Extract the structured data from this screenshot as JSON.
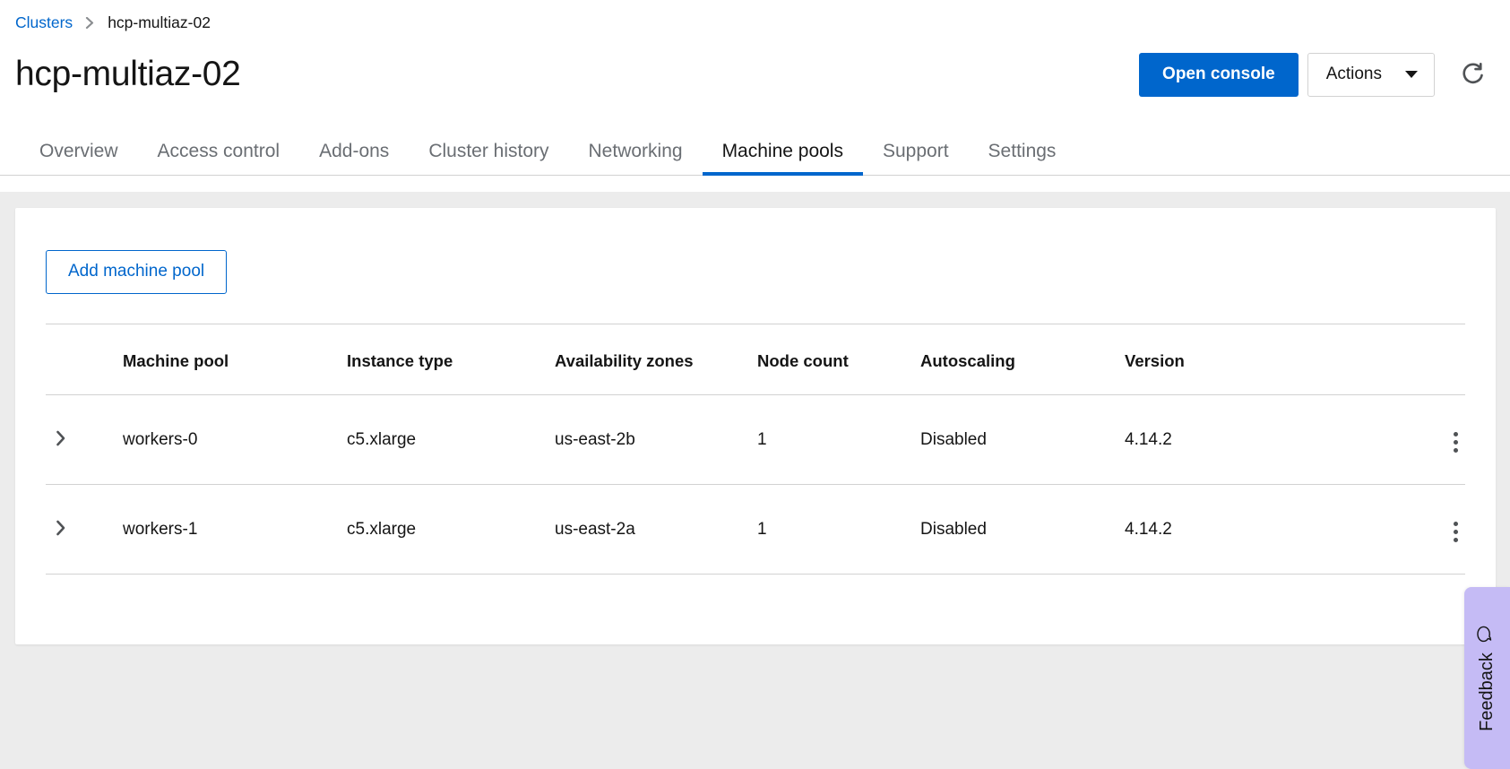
{
  "breadcrumb": {
    "root_label": "Clusters",
    "separator": "›",
    "current_label": "hcp-multiaz-02"
  },
  "header": {
    "title": "hcp-multiaz-02",
    "open_console_label": "Open console",
    "actions_label": "Actions",
    "refresh_icon": "refresh-icon"
  },
  "tabs": [
    {
      "label": "Overview",
      "active": false
    },
    {
      "label": "Access control",
      "active": false
    },
    {
      "label": "Add-ons",
      "active": false
    },
    {
      "label": "Cluster history",
      "active": false
    },
    {
      "label": "Networking",
      "active": false
    },
    {
      "label": "Machine pools",
      "active": true
    },
    {
      "label": "Support",
      "active": false
    },
    {
      "label": "Settings",
      "active": false
    }
  ],
  "toolbar": {
    "add_machine_pool_label": "Add machine pool"
  },
  "table": {
    "columns": [
      "Machine pool",
      "Instance type",
      "Availability zones",
      "Node count",
      "Autoscaling",
      "Version"
    ],
    "rows": [
      {
        "machine_pool": "workers-0",
        "instance_type": "c5.xlarge",
        "availability_zones": "us-east-2b",
        "node_count": "1",
        "autoscaling": "Disabled",
        "version": "4.14.2"
      },
      {
        "machine_pool": "workers-1",
        "instance_type": "c5.xlarge",
        "availability_zones": "us-east-2a",
        "node_count": "1",
        "autoscaling": "Disabled",
        "version": "4.14.2"
      }
    ]
  },
  "feedback": {
    "label": "Feedback",
    "icon": "comment-icon",
    "background_color": "#c5bbf5"
  },
  "colors": {
    "primary_blue": "#0066cc",
    "link_blue": "#0066cc",
    "page_background": "#ececec",
    "text": "#151515",
    "muted_text": "#6a6e73",
    "border": "#d2d2d2"
  }
}
